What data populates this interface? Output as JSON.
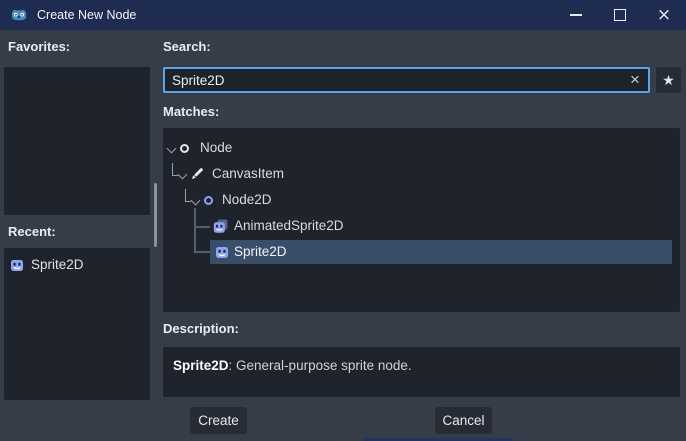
{
  "window": {
    "title": "Create New Node"
  },
  "icons": {
    "close": "×",
    "clear": "×",
    "star": "★"
  },
  "sidebar": {
    "favorites_label": "Favorites:",
    "recent_label": "Recent:",
    "recent_items": [
      {
        "label": "Sprite2D",
        "icon": "sprite2d-icon"
      }
    ]
  },
  "search": {
    "label": "Search:",
    "value": "Sprite2D"
  },
  "matches": {
    "label": "Matches:",
    "tree": [
      {
        "label": "Node",
        "icon": "node-icon",
        "depth": 0,
        "muted": false,
        "selected": false
      },
      {
        "label": "CanvasItem",
        "icon": "canvasitem-icon",
        "depth": 1,
        "muted": true,
        "selected": false
      },
      {
        "label": "Node2D",
        "icon": "node2d-icon",
        "depth": 2,
        "muted": false,
        "selected": false
      },
      {
        "label": "AnimatedSprite2D",
        "icon": "animatedsprite2d-icon",
        "depth": 3,
        "muted": false,
        "selected": false
      },
      {
        "label": "Sprite2D",
        "icon": "sprite2d-icon",
        "depth": 3,
        "muted": false,
        "selected": true
      }
    ]
  },
  "description": {
    "label": "Description:",
    "term": "Sprite2D",
    "text": ": General-purpose sprite node."
  },
  "actions": {
    "create": "Create",
    "cancel": "Cancel"
  },
  "colors": {
    "titlebar": "#1f2c52",
    "dialog_bg": "#363d49",
    "panel_bg": "#1e232c",
    "accent_border": "#57a6ee",
    "selection": "#3a4d69",
    "node2d_blue": "#8da5f3",
    "godot_blue": "#478cbf"
  }
}
